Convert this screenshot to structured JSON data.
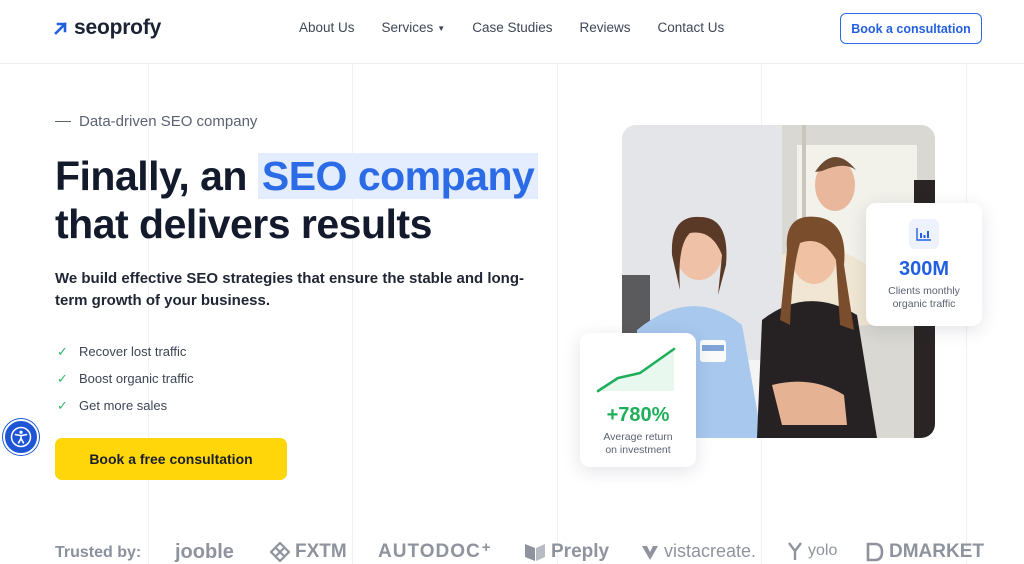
{
  "header": {
    "logo_text": "seoprofy",
    "nav": [
      {
        "label": "About Us"
      },
      {
        "label": "Services",
        "has_dropdown": true
      },
      {
        "label": "Case Studies"
      },
      {
        "label": "Reviews"
      },
      {
        "label": "Contact Us"
      }
    ],
    "cta_label": "Book a consultation"
  },
  "hero": {
    "tagline": "Data-driven SEO company",
    "headline_part1": "Finally, an ",
    "headline_highlight": "SEO company",
    "headline_part2": "that delivers results",
    "subheadline": "We build effective SEO strategies that ensure the stable and long-term growth of your business.",
    "benefits": [
      "Recover lost traffic",
      "Boost organic traffic",
      "Get more sales"
    ],
    "cta_label": "Book a free consultation"
  },
  "stats": {
    "traffic": {
      "value": "300M",
      "caption_line1": "Clients monthly",
      "caption_line2": "organic traffic"
    },
    "roi": {
      "value": "+780%",
      "caption_line1": "Average return",
      "caption_line2": "on investment"
    }
  },
  "trusted": {
    "label": "Trusted by:",
    "brands": [
      "jooble",
      "FXTM",
      "AUTODOC",
      "Preply",
      "vistacreate.",
      "yolo",
      "DMARKET"
    ]
  },
  "colors": {
    "accent_blue": "#2360e0",
    "cta_yellow": "#ffd60a",
    "success_green": "#1fae5a"
  }
}
